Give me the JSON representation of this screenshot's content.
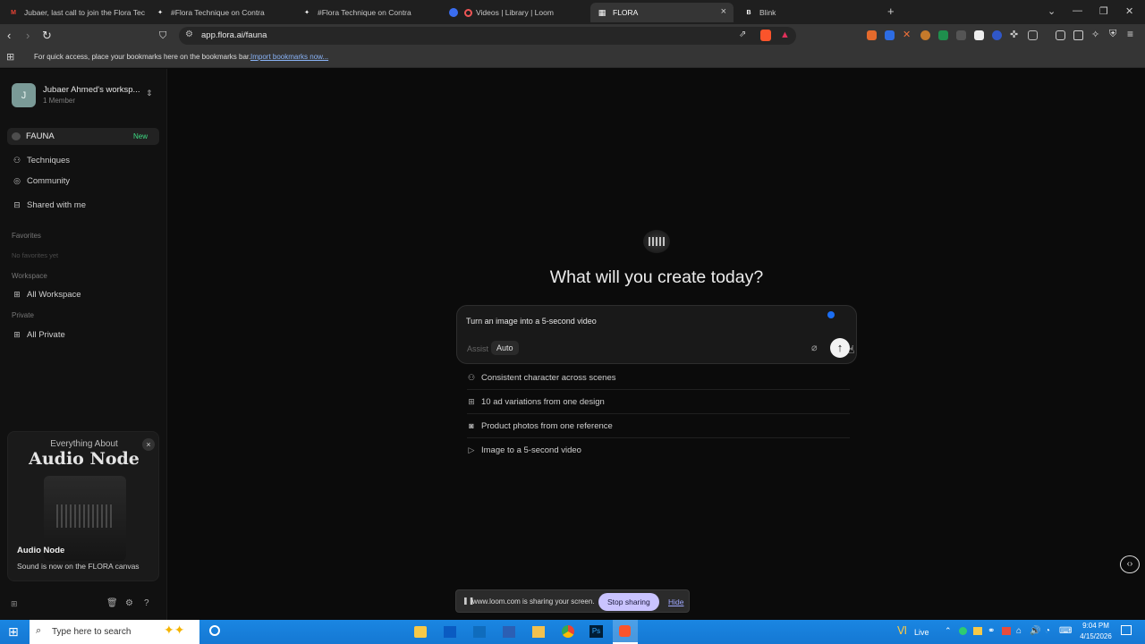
{
  "browser": {
    "tabs": [
      {
        "label": "Jubaer, last call to join the Flora Tech",
        "icon": "gmail-icon"
      },
      {
        "label": "#Flora Technique on Contra",
        "icon": "contra-icon"
      },
      {
        "label": "#Flora Technique on Contra",
        "icon": "contra-icon"
      },
      {
        "label": "Videos | Library | Loom",
        "icon": "loom-icon"
      },
      {
        "label": "FLORA",
        "icon": "flora-icon"
      },
      {
        "label": "Blink",
        "icon": "blink-icon"
      }
    ],
    "active_tab_close": "×",
    "new_tab": "+",
    "url": "app.flora.ai/fauna",
    "bookmarks_bar_text": "For quick access, place your bookmarks here on the bookmarks bar.",
    "bookmarks_import_link": "Import bookmarks now..."
  },
  "sidebar": {
    "avatar_letter": "J",
    "workspace_name": "Jubaer Ahmed's worksp...",
    "workspace_members": "1 Member",
    "fauna_label": "FAUNA",
    "fauna_badge": "New",
    "nav": [
      {
        "label": "Techniques",
        "icon": "user-icon"
      },
      {
        "label": "Community",
        "icon": "globe-icon"
      },
      {
        "label": "Shared with me",
        "icon": "inbox-icon"
      }
    ],
    "favorites_heading": "Favorites",
    "favorites_empty": "No favorites yet",
    "workspace_heading": "Workspace",
    "workspace_item": "All Workspace",
    "private_heading": "Private",
    "private_item": "All Private",
    "promo": {
      "kicker": "Everything About",
      "title": "Audio Node",
      "card_title": "Audio Node",
      "card_text": "Sound is now on the FLORA canvas"
    }
  },
  "main": {
    "headline": "What will you create today?",
    "prompt_text": "Turn an image into a 5-second video",
    "mode_assist": "Assist",
    "mode_auto": "Auto",
    "suggestions": [
      {
        "label": "Consistent character across scenes",
        "icon": "people-icon"
      },
      {
        "label": "10 ad variations from one design",
        "icon": "grid-icon"
      },
      {
        "label": "Product photos from one reference",
        "icon": "camera-icon"
      },
      {
        "label": "Image to a 5-second video",
        "icon": "play-icon"
      }
    ]
  },
  "share_bar": {
    "text": "www.loom.com is sharing your screen.",
    "stop_button": "Stop sharing",
    "hide_link": "Hide"
  },
  "taskbar": {
    "search_placeholder": "Type here to search",
    "weather_label": "Live",
    "time": "9:04 PM",
    "date": "4/15/2026"
  },
  "colors": {
    "accent_blue": "#1b6ef3",
    "badge_green": "#3ddc84",
    "taskbar_blue": "#1a86e2",
    "stop_sharing_bg": "#c9c3ff"
  }
}
